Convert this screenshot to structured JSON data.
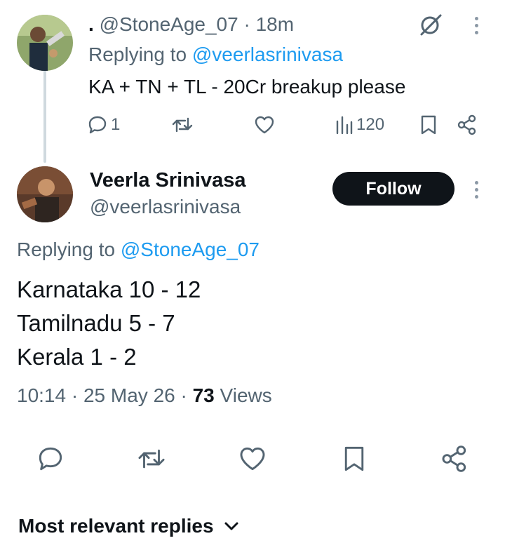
{
  "reply_tweet": {
    "author_name": ".",
    "handle": "@StoneAge_07",
    "separator": "·",
    "time": "18m",
    "replying_prefix": "Replying to",
    "replying_handle": "@veerlasrinivasa",
    "text": "KA + TN + TL - 20Cr breakup please",
    "reply_count": "1",
    "views_count": "120"
  },
  "main_tweet": {
    "display_name": "Veerla Srinivasa",
    "handle": "@veerlasrinivasa",
    "follow_label": "Follow",
    "replying_prefix": "Replying to",
    "replying_handle": "@StoneAge_07",
    "lines": [
      "Karnataka 10 - 12",
      "Tamilnadu 5 - 7",
      "Kerala 1 - 2"
    ],
    "time": "10:14",
    "sep1": "·",
    "date": "25 May 26",
    "sep2": "·",
    "views_count": "73",
    "views_label": "Views"
  },
  "sort": {
    "label": "Most relevant replies"
  },
  "colors": {
    "text": "#0f1419",
    "muted": "#536471",
    "link": "#1d9bf0",
    "button_bg": "#0f1419",
    "thread_line": "#cfd9de"
  },
  "icons": {
    "reply": "reply-bubble-icon",
    "retweet": "retweet-icon",
    "like": "heart-icon",
    "views": "bar-chart-icon",
    "bookmark": "bookmark-icon",
    "share": "share-icon",
    "more": "more-vertical-icon",
    "grok": "grok-icon",
    "chevron": "chevron-down-icon"
  }
}
